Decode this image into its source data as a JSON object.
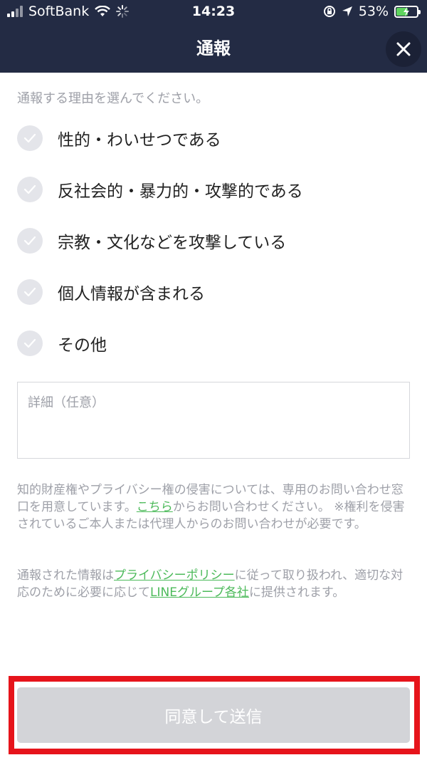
{
  "status_bar": {
    "carrier": "SoftBank",
    "time": "14:23",
    "battery": "53%"
  },
  "header": {
    "title": "通報"
  },
  "form": {
    "instruction": "通報する理由を選んでください。",
    "reasons": [
      {
        "label": "性的・わいせつである"
      },
      {
        "label": "反社会的・暴力的・攻撃的である"
      },
      {
        "label": "宗教・文化などを攻撃している"
      },
      {
        "label": "個人情報が含まれる"
      },
      {
        "label": "その他"
      }
    ],
    "details_placeholder": "詳細（任意）"
  },
  "notice": {
    "p1_before": "知的財産権やプライバシー権の侵害については、専用のお問い合わせ窓口を用意しています。",
    "p1_link": "こちら",
    "p1_after": "からお問い合わせください。 ※権利を侵害されているご本人または代理人からのお問い合わせが必要です。",
    "p2_before": "通報された情報は",
    "p2_link1": "プライバシーポリシー",
    "p2_middle": "に従って取り扱われ、適切な対応のために必要に応じて",
    "p2_link2": "LINEグループ各社",
    "p2_after": "に提供されます。"
  },
  "footer": {
    "submit_label": "同意して送信"
  },
  "colors": {
    "header_bg": "#232b44",
    "link": "#4cba5a",
    "highlight": "#e6141b",
    "button_disabled": "#d3d4d8"
  }
}
